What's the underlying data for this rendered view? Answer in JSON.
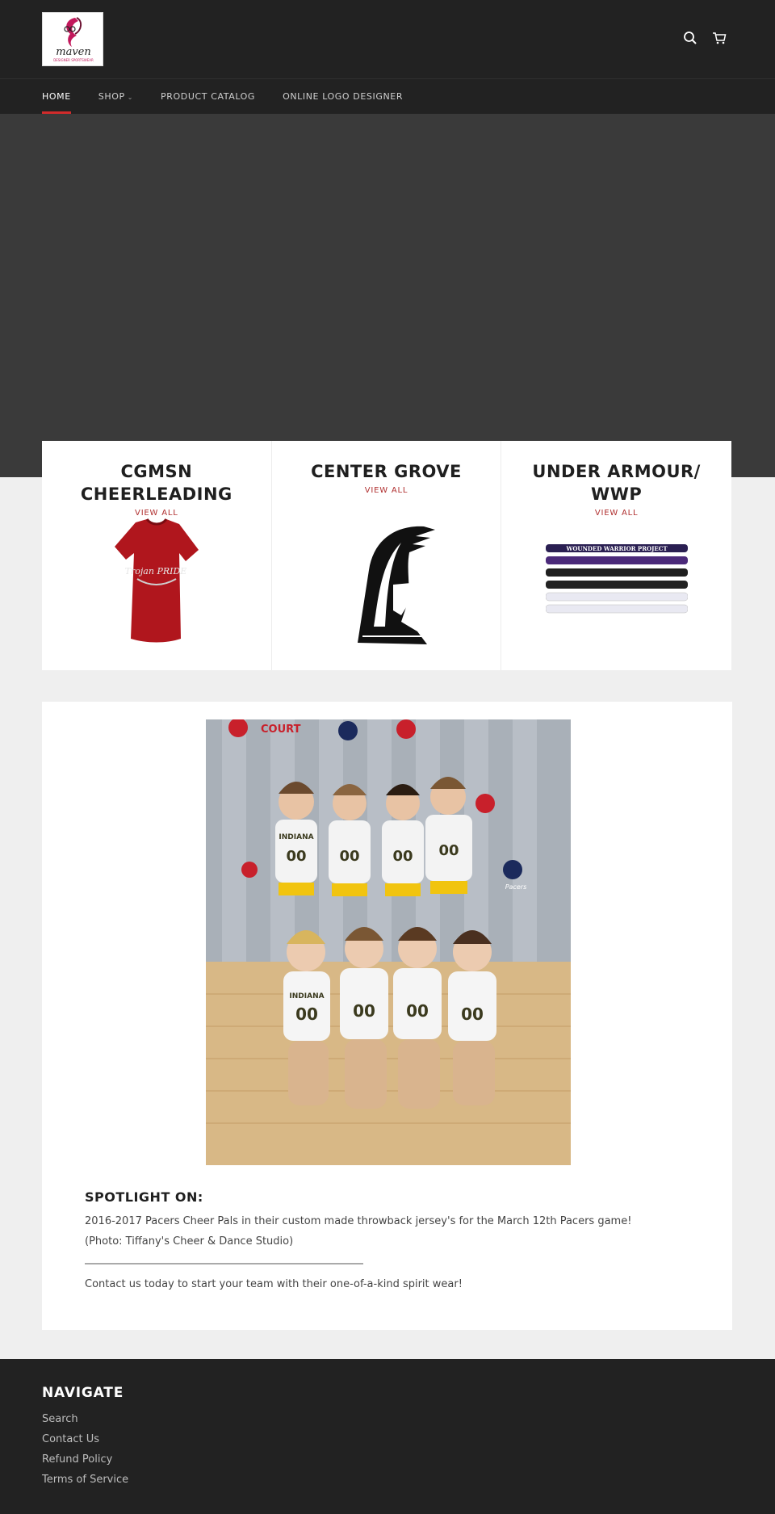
{
  "logo": {
    "text": "maven",
    "subtext": "DESIGNER SPORTSWEAR"
  },
  "nav": {
    "items": [
      {
        "label": "HOME"
      },
      {
        "label": "SHOP"
      },
      {
        "label": "PRODUCT CATALOG"
      },
      {
        "label": "ONLINE LOGO DESIGNER"
      }
    ]
  },
  "collections": [
    {
      "title": "CGMSN CHEERLEADING",
      "link": "VIEW ALL",
      "shirt_text": "Trojan PRIDE"
    },
    {
      "title": "CENTER GROVE",
      "link": "VIEW ALL"
    },
    {
      "title": "UNDER ARMOUR/ WWP",
      "link": "VIEW ALL",
      "band_text": "WOUNDED WARRIOR PROJECT"
    }
  ],
  "feature": {
    "spotlight_title": "SPOTLIGHT ON:",
    "line1": "2016-2017 Pacers Cheer Pals in their custom made throwback jersey's for the March 12th Pacers game!",
    "line2": "(Photo: Tiffany's Cheer & Dance Studio)",
    "line3": "Contact us today to start your team with their one-of-a-kind spirit wear!",
    "photo_texts": {
      "banner": "COURT",
      "jersey": "INDIANA",
      "number": "00",
      "team": "Pacers"
    }
  },
  "footer": {
    "title": "NAVIGATE",
    "links": [
      "Search",
      "Contact Us",
      "Refund Policy",
      "Terms of Service"
    ]
  },
  "colors": {
    "header_bg": "#222222",
    "accent": "#d12b2b",
    "hero_bg": "#3a3a3a",
    "page_bg": "#efefef"
  },
  "icons": [
    "search-icon",
    "cart-icon",
    "chevron-down-icon"
  ]
}
